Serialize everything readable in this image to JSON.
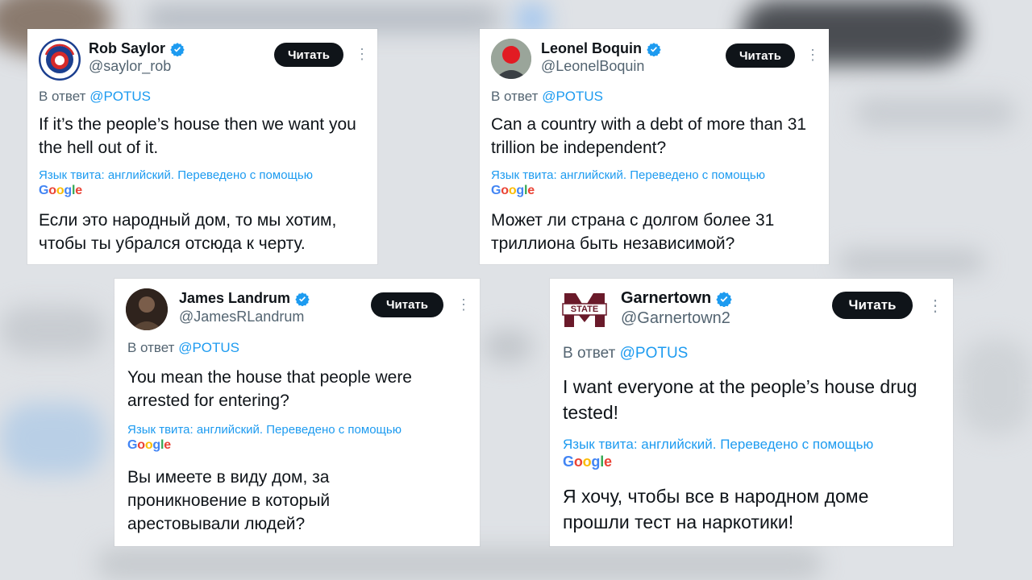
{
  "tweets": [
    {
      "name": "Rob Saylor",
      "handle": "@saylor_rob",
      "follow_label": "Читать",
      "reply_prefix": "В ответ",
      "reply_to": "@POTUS",
      "text": "If it’s the people’s house then we want you the hell out of it.",
      "translation_note": "Язык твита: английский. Переведено с помощью",
      "translator": "Google",
      "translation": "Если это народный дом, то мы хотим, чтобы ты убрался отсюда к черту."
    },
    {
      "name": "Leonel Boquin",
      "handle": "@LeonelBoquin",
      "follow_label": "Читать",
      "reply_prefix": "В ответ",
      "reply_to": "@POTUS",
      "text": "Can a country with a debt of more than 31 trillion be independent?",
      "translation_note": "Язык твита: английский. Переведено с помощью",
      "translator": "Google",
      "translation": "Может ли страна с долгом более 31 триллиона быть независимой?"
    },
    {
      "name": "James Landrum",
      "handle": "@JamesRLandrum",
      "follow_label": "Читать",
      "reply_prefix": "В ответ",
      "reply_to": "@POTUS",
      "text": "You mean the house that people were arrested for entering?",
      "translation_note": "Язык твита: английский. Переведено с помощью",
      "translator": "Google",
      "translation": "Вы имеете в виду дом, за проникновение в который арестовывали людей?"
    },
    {
      "name": "Garnertown",
      "handle": "@Garnertown2",
      "follow_label": "Читать",
      "reply_prefix": "В ответ",
      "reply_to": "@POTUS",
      "text": "I want everyone at the people’s house drug tested!",
      "translation_note": "Язык твита: английский. Переведено с помощью",
      "translator": "Google",
      "translation": "Я хочу, чтобы все в народном доме прошли тест на наркотики!",
      "avatar_text": "STATE"
    }
  ],
  "colors": {
    "verified": "#1d9bf0",
    "mention": "#1d9bf0",
    "follow_button": "#0f1419"
  },
  "icons": {
    "verified": "verified-badge-icon",
    "more": "more-dots-icon"
  }
}
